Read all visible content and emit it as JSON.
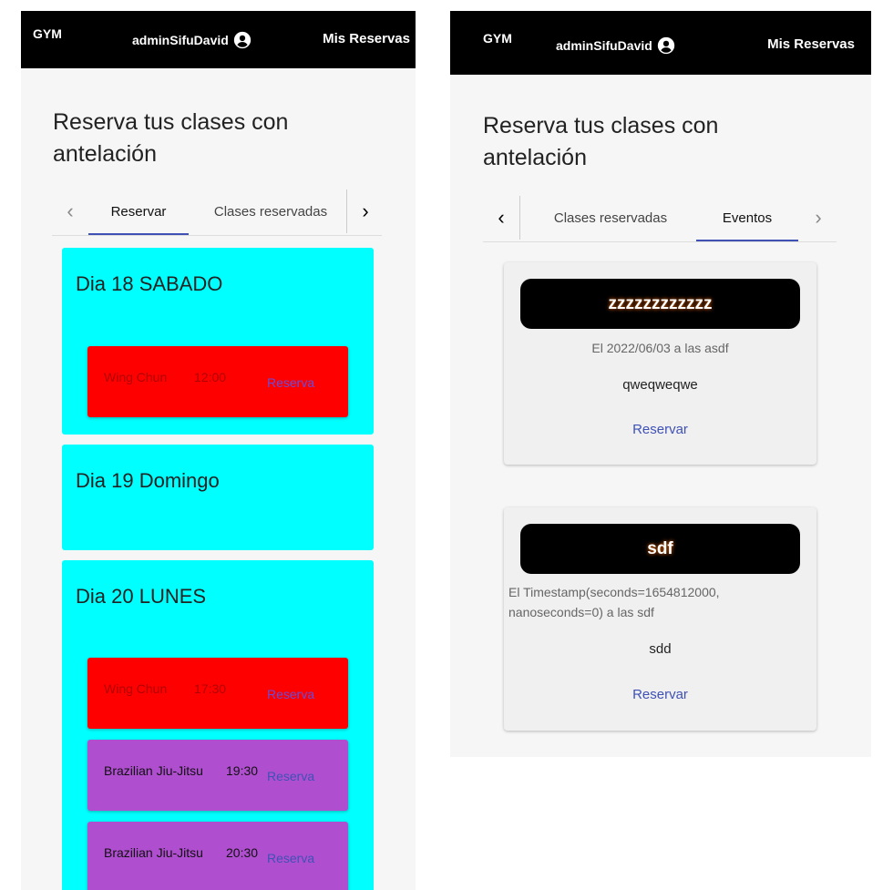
{
  "app": {
    "brand": "GYM",
    "username": "adminSifuDavid",
    "my_bookings_link": "Mis Reservas"
  },
  "page": {
    "title": "Reserva tus clases con antelación"
  },
  "tabs": {
    "reservar": "Reservar",
    "clases_reservadas": "Clases reservadas",
    "eventos": "Eventos"
  },
  "left_screen": {
    "active_tab": "Reservar",
    "days": [
      {
        "title": "Dia 18 SABADO",
        "slots": [
          {
            "class_name": "Wing Chun",
            "time": "12:00",
            "button": "Reserva",
            "color": "#ff0000"
          }
        ]
      },
      {
        "title": "Dia 19 Domingo",
        "slots": []
      },
      {
        "title": "Dia 20 LUNES",
        "slots": [
          {
            "class_name": "Wing Chun",
            "time": "17:30",
            "button": "Reserva",
            "color": "#ff0000"
          },
          {
            "class_name": "Brazilian Jiu-Jitsu",
            "time": "19:30",
            "button": "Reserva",
            "color": "#b04ed0"
          },
          {
            "class_name": "Brazilian Jiu-Jitsu",
            "time": "20:30",
            "button": "Reserva",
            "color": "#b04ed0"
          }
        ]
      }
    ]
  },
  "right_screen": {
    "active_tab": "Eventos",
    "events": [
      {
        "title": "zzzzzzzzzzzz",
        "date_line": "El 2022/06/03 a las asdf",
        "description": "qweqweqwe",
        "button": "Reservar"
      },
      {
        "title": "sdf",
        "date_line": "El Timestamp(seconds=1654812000, nanoseconds=0) a las sdf",
        "description": "sdd",
        "button": "Reservar"
      }
    ]
  },
  "colors": {
    "appbar": "#000000",
    "day_card": "#00ffff",
    "accent": "#3f51b5",
    "slot_wing_chun": "#ff0000",
    "slot_bjj": "#b04ed0"
  }
}
